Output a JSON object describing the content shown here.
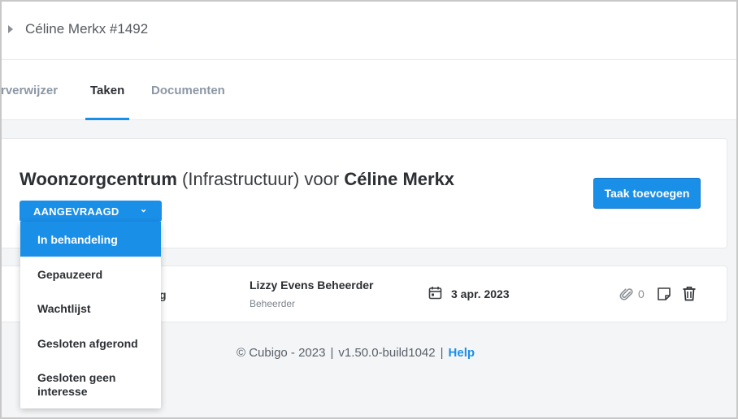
{
  "header": {
    "title": "Céline Merkx #1492"
  },
  "tabs": [
    {
      "label": "rverwijzer",
      "active": false
    },
    {
      "label": "Taken",
      "active": true
    },
    {
      "label": "Documenten",
      "active": false
    }
  ],
  "task_card": {
    "title_bold_1": "Woonzorgcentrum",
    "title_mid": " (Infrastructuur) voor ",
    "title_bold_2": "Céline Merkx",
    "status_label": "AANGEVRAAGD",
    "add_button": "Taak toevoegen"
  },
  "status_options": [
    {
      "label": "In behandeling",
      "selected": true
    },
    {
      "label": "Gepauzeerd",
      "selected": false
    },
    {
      "label": "Wachtlijst",
      "selected": false
    },
    {
      "label": "Gesloten afgerond",
      "selected": false
    },
    {
      "label": "Gesloten geen interesse",
      "selected": false
    }
  ],
  "task_row": {
    "fragment": "g",
    "person_name": "Lizzy Evens Beheerder",
    "person_role": "Beheerder",
    "date": "3 apr. 2023",
    "attachment_count": "0"
  },
  "footer": {
    "copyright": "© Cubigo - 2023",
    "version": "v1.50.0-build1042",
    "help": "Help"
  },
  "colors": {
    "accent": "#1a8fe8",
    "background": "#f4f5f7"
  }
}
